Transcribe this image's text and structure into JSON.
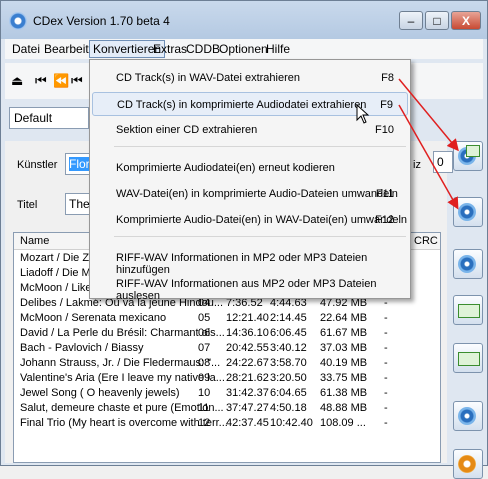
{
  "window": {
    "title": "CDex Version 1.70 beta 4",
    "controls": {
      "minimize": "–",
      "maximize": "□",
      "close": "X"
    }
  },
  "menubar": [
    "Datei",
    "Bearbeiten",
    "Konvertieren",
    "Extras",
    "CDDB",
    "Optionen",
    "Hilfe"
  ],
  "active_menu": "Konvertieren",
  "popup_menu": [
    {
      "label": "CD Track(s) in WAV-Datei extrahieren",
      "key": "F8"
    },
    {
      "label": "CD Track(s) in komprimierte Audiodatei extrahieren",
      "key": "F9",
      "highlighted": true
    },
    {
      "label": "Sektion einer CD extrahieren",
      "key": "F10"
    },
    {
      "label": "Komprimierte Audiodatei(en) erneut kodieren",
      "key": ""
    },
    {
      "label": "WAV-Datei(en) in komprimierte Audio-Dateien umwandeln",
      "key": "F11"
    },
    {
      "label": "Komprimierte Audio-Datei(en) in WAV-Datei(en) umwandeln",
      "key": "F12"
    },
    {
      "label": "RIFF-WAV Informationen in MP2 oder MP3 Dateien hinzufügen",
      "key": ""
    },
    {
      "label": "RIFF-WAV Informationen aus MP2 oder MP3 Dateien auslesen",
      "key": ""
    }
  ],
  "profile": "Default",
  "fields": {
    "artist_label": "Künstler",
    "artist_value": "Floren",
    "title_label": "Titel",
    "title_value": "The G",
    "right_label": "iz",
    "right_value": "0"
  },
  "table": {
    "headers": {
      "name": "Name",
      "crc": "CRC"
    },
    "rows": [
      {
        "name": "Mozart / Die Zauber",
        "track": "",
        "start": "",
        "length": "",
        "size": "",
        "crc": "-"
      },
      {
        "name": "Liadoff / Die Musikd",
        "track": "",
        "start": "",
        "length": "",
        "size": "",
        "crc": "-"
      },
      {
        "name": "McMoon / Like a Br",
        "track": "",
        "start": "",
        "length": "",
        "size": "",
        "crc": "-"
      },
      {
        "name": "Delibes / Lakmé: Où va la jeune Hindou...",
        "track": "04",
        "start": "7:36.52",
        "length": "4:44.63",
        "size": "47.92 MB",
        "crc": "-"
      },
      {
        "name": "McMoon / Serenata mexicano",
        "track": "05",
        "start": "12:21.40",
        "length": "2:14.45",
        "size": "22.64 MB",
        "crc": "-"
      },
      {
        "name": "David / La Perle du Brésil: Charmant ois...",
        "track": "06",
        "start": "14:36.10",
        "length": "6:06.45",
        "size": "61.67 MB",
        "crc": "-"
      },
      {
        "name": "Bach - Pavlovich / Biassy",
        "track": "07",
        "start": "20:42.55",
        "length": "3:40.12",
        "size": "37.03 MB",
        "crc": "-"
      },
      {
        "name": "Johann Strauss, Jr. / Die Fledermaus: \"...",
        "track": "08",
        "start": "24:22.67",
        "length": "3:58.70",
        "size": "40.19 MB",
        "crc": "-"
      },
      {
        "name": "Valentine's Aria (Ere I leave my native la...",
        "track": "09",
        "start": "28:21.62",
        "length": "3:20.50",
        "size": "33.75 MB",
        "crc": "-"
      },
      {
        "name": "Jewel Song ( O heavenly jewels)",
        "track": "10",
        "start": "31:42.37",
        "length": "6:04.65",
        "size": "61.38 MB",
        "crc": "-"
      },
      {
        "name": "Salut, demeure chaste et pure (Emotion...",
        "track": "11",
        "start": "37:47.27",
        "length": "4:50.18",
        "size": "48.88 MB",
        "crc": "-"
      },
      {
        "name": "Final Trio (My heart is overcome with terr...",
        "track": "12",
        "start": "42:37.45",
        "length": "10:42.40",
        "size": "108.09 ...",
        "crc": "-"
      }
    ]
  },
  "sidebar_icons": [
    "extract-wav-icon",
    "extract-compressed-icon",
    "extract-section-icon",
    "reencode-icon",
    "wav-to-compressed-icon",
    "compressed-to-wav-icon",
    "search-icon",
    "settings-icon"
  ],
  "colors": {
    "arrow": "#e02020",
    "selection": "#3399ff",
    "highlight": "#e7eef8"
  }
}
